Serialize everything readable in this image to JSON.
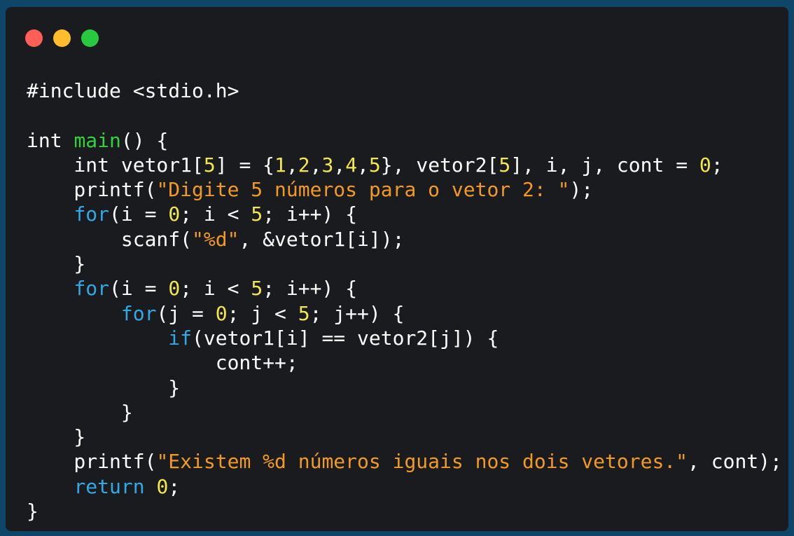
{
  "window": {
    "controls": [
      {
        "name": "close",
        "color": "#ff5f57"
      },
      {
        "name": "minimize",
        "color": "#ffbd2e"
      },
      {
        "name": "maximize",
        "color": "#28c840"
      }
    ]
  },
  "code": {
    "language": "c",
    "lines": [
      [
        {
          "t": "plain",
          "v": "#include <stdio.h>"
        }
      ],
      [],
      [
        {
          "t": "plain",
          "v": "int "
        },
        {
          "t": "fn",
          "v": "main"
        },
        {
          "t": "plain",
          "v": "() {"
        }
      ],
      [
        {
          "t": "plain",
          "v": "    int vetor1["
        },
        {
          "t": "num",
          "v": "5"
        },
        {
          "t": "plain",
          "v": "] = {"
        },
        {
          "t": "num",
          "v": "1"
        },
        {
          "t": "plain",
          "v": ","
        },
        {
          "t": "num",
          "v": "2"
        },
        {
          "t": "plain",
          "v": ","
        },
        {
          "t": "num",
          "v": "3"
        },
        {
          "t": "plain",
          "v": ","
        },
        {
          "t": "num",
          "v": "4"
        },
        {
          "t": "plain",
          "v": ","
        },
        {
          "t": "num",
          "v": "5"
        },
        {
          "t": "plain",
          "v": "}, vetor2["
        },
        {
          "t": "num",
          "v": "5"
        },
        {
          "t": "plain",
          "v": "], i, j, cont = "
        },
        {
          "t": "num",
          "v": "0"
        },
        {
          "t": "plain",
          "v": ";"
        }
      ],
      [
        {
          "t": "plain",
          "v": "    printf("
        },
        {
          "t": "str",
          "v": "\"Digite 5 números para o vetor 2: \""
        },
        {
          "t": "plain",
          "v": ");"
        }
      ],
      [
        {
          "t": "plain",
          "v": "    "
        },
        {
          "t": "kw",
          "v": "for"
        },
        {
          "t": "plain",
          "v": "(i = "
        },
        {
          "t": "num",
          "v": "0"
        },
        {
          "t": "plain",
          "v": "; i < "
        },
        {
          "t": "num",
          "v": "5"
        },
        {
          "t": "plain",
          "v": "; i++) {"
        }
      ],
      [
        {
          "t": "plain",
          "v": "        scanf("
        },
        {
          "t": "str",
          "v": "\"%d\""
        },
        {
          "t": "plain",
          "v": ", &vetor1[i]);"
        }
      ],
      [
        {
          "t": "plain",
          "v": "    }"
        }
      ],
      [
        {
          "t": "plain",
          "v": "    "
        },
        {
          "t": "kw",
          "v": "for"
        },
        {
          "t": "plain",
          "v": "(i = "
        },
        {
          "t": "num",
          "v": "0"
        },
        {
          "t": "plain",
          "v": "; i < "
        },
        {
          "t": "num",
          "v": "5"
        },
        {
          "t": "plain",
          "v": "; i++) {"
        }
      ],
      [
        {
          "t": "plain",
          "v": "        "
        },
        {
          "t": "kw",
          "v": "for"
        },
        {
          "t": "plain",
          "v": "(j = "
        },
        {
          "t": "num",
          "v": "0"
        },
        {
          "t": "plain",
          "v": "; j < "
        },
        {
          "t": "num",
          "v": "5"
        },
        {
          "t": "plain",
          "v": "; j++) {"
        }
      ],
      [
        {
          "t": "plain",
          "v": "            "
        },
        {
          "t": "kw",
          "v": "if"
        },
        {
          "t": "plain",
          "v": "(vetor1[i] == vetor2[j]) {"
        }
      ],
      [
        {
          "t": "plain",
          "v": "                cont++;"
        }
      ],
      [
        {
          "t": "plain",
          "v": "            }"
        }
      ],
      [
        {
          "t": "plain",
          "v": "        }"
        }
      ],
      [
        {
          "t": "plain",
          "v": "    }"
        }
      ],
      [
        {
          "t": "plain",
          "v": "    printf("
        },
        {
          "t": "str",
          "v": "\"Existem %d números iguais nos dois vetores.\""
        },
        {
          "t": "plain",
          "v": ", cont);"
        }
      ],
      [
        {
          "t": "plain",
          "v": "    "
        },
        {
          "t": "kw",
          "v": "return"
        },
        {
          "t": "plain",
          "v": " "
        },
        {
          "t": "num",
          "v": "0"
        },
        {
          "t": "plain",
          "v": ";"
        }
      ],
      [
        {
          "t": "plain",
          "v": "}"
        }
      ]
    ]
  }
}
